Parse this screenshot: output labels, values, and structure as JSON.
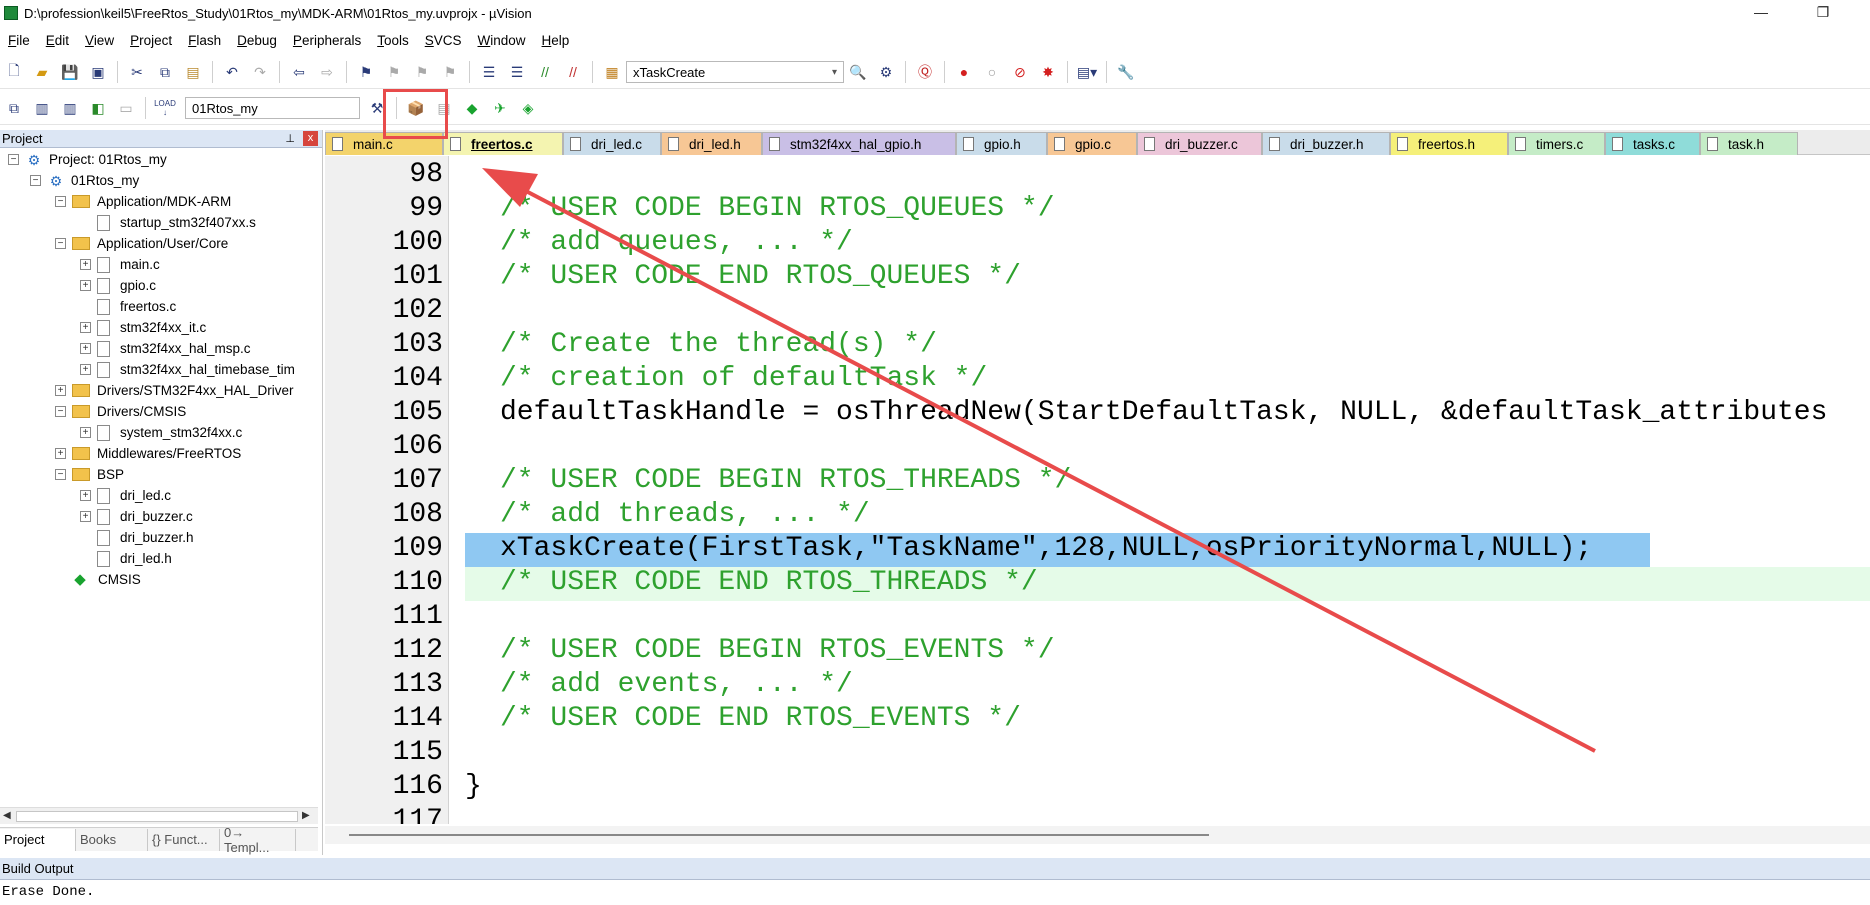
{
  "window": {
    "title": "D:\\profession\\keil5\\FreeRtos_Study\\01Rtos_my\\MDK-ARM\\01Rtos_my.uvprojx - µVision",
    "minimize": "—",
    "restore": "❐"
  },
  "menu": [
    {
      "label": "File",
      "u": "F",
      "rest": "ile"
    },
    {
      "label": "Edit",
      "u": "E",
      "rest": "dit"
    },
    {
      "label": "View",
      "u": "V",
      "rest": "iew"
    },
    {
      "label": "Project",
      "u": "P",
      "rest": "roject"
    },
    {
      "label": "Flash",
      "u": "F",
      "rest": "lash"
    },
    {
      "label": "Debug",
      "u": "D",
      "rest": "ebug"
    },
    {
      "label": "Peripherals",
      "u": "P",
      "rest": "eripherals"
    },
    {
      "label": "Tools",
      "u": "T",
      "rest": "ools"
    },
    {
      "label": "SVCS",
      "u": "S",
      "rest": "VCS"
    },
    {
      "label": "Window",
      "u": "W",
      "rest": "indow"
    },
    {
      "label": "Help",
      "u": "H",
      "rest": "elp"
    }
  ],
  "toolbar1": {
    "find_combo": "xTaskCreate"
  },
  "toolbar2": {
    "target_combo": "01Rtos_my",
    "load_label": "LOAD"
  },
  "project_panel": {
    "title": "Project",
    "pin": "⊥",
    "close": "x",
    "tree": [
      {
        "label": "Project: 01Rtos_my"
      },
      {
        "label": "01Rtos_my"
      },
      {
        "label": "Application/MDK-ARM"
      },
      {
        "label": "startup_stm32f407xx.s"
      },
      {
        "label": "Application/User/Core"
      },
      {
        "label": "main.c"
      },
      {
        "label": "gpio.c"
      },
      {
        "label": "freertos.c"
      },
      {
        "label": "stm32f4xx_it.c"
      },
      {
        "label": "stm32f4xx_hal_msp.c"
      },
      {
        "label": "stm32f4xx_hal_timebase_tim"
      },
      {
        "label": "Drivers/STM32F4xx_HAL_Driver"
      },
      {
        "label": "Drivers/CMSIS"
      },
      {
        "label": "system_stm32f4xx.c"
      },
      {
        "label": "Middlewares/FreeRTOS"
      },
      {
        "label": "BSP"
      },
      {
        "label": "dri_led.c"
      },
      {
        "label": "dri_buzzer.c"
      },
      {
        "label": "dri_buzzer.h"
      },
      {
        "label": "dri_led.h"
      },
      {
        "label": "CMSIS"
      }
    ],
    "bottom_tabs": [
      "Project",
      "Books",
      "{} Funct...",
      "0→ Templ..."
    ]
  },
  "editor_tabs": [
    {
      "label": "main.c"
    },
    {
      "label": "freertos.c"
    },
    {
      "label": "dri_led.c"
    },
    {
      "label": "dri_led.h"
    },
    {
      "label": "stm32f4xx_hal_gpio.h"
    },
    {
      "label": "gpio.h"
    },
    {
      "label": "gpio.c"
    },
    {
      "label": "dri_buzzer.c"
    },
    {
      "label": "dri_buzzer.h"
    },
    {
      "label": "freertos.h"
    },
    {
      "label": "timers.c"
    },
    {
      "label": "tasks.c"
    },
    {
      "label": "task.h"
    }
  ],
  "editor": {
    "lines": [
      {
        "num": "98",
        "text": ""
      },
      {
        "num": "99",
        "text": "/* USER CODE BEGIN RTOS_QUEUES */"
      },
      {
        "num": "100",
        "text": "/* add queues, ... */"
      },
      {
        "num": "101",
        "text": "/* USER CODE END RTOS_QUEUES */"
      },
      {
        "num": "102",
        "text": ""
      },
      {
        "num": "103",
        "text": "/* Create the thread(s) */"
      },
      {
        "num": "104",
        "text": "/* creation of defaultTask */"
      },
      {
        "num": "105",
        "text": "defaultTaskHandle = osThreadNew(StartDefaultTask, NULL, &defaultTask_attributes"
      },
      {
        "num": "106",
        "text": ""
      },
      {
        "num": "107",
        "text": "/* USER CODE BEGIN RTOS_THREADS */"
      },
      {
        "num": "108",
        "text": "/* add threads, ... */"
      },
      {
        "num": "109",
        "text": "xTaskCreate(FirstTask,\"TaskName\",128,NULL,osPriorityNormal,NULL);"
      },
      {
        "num": "110",
        "text": "/* USER CODE END RTOS_THREADS */"
      },
      {
        "num": "111",
        "text": ""
      },
      {
        "num": "112",
        "text": "/* USER CODE BEGIN RTOS_EVENTS */"
      },
      {
        "num": "113",
        "text": "/* add events, ... */"
      },
      {
        "num": "114",
        "text": "/* USER CODE END RTOS_EVENTS */"
      },
      {
        "num": "115",
        "text": ""
      },
      {
        "num": "116",
        "text": "}"
      },
      {
        "num": "117",
        "text": ""
      }
    ]
  },
  "build_output": {
    "title": "Build Output",
    "text": "Erase Done."
  },
  "colors": {
    "comment": "#2ea12e",
    "highlight_current": "#8fc8f2",
    "highlight_line": "#e5fbe8",
    "annotation": "#e84b4b"
  }
}
